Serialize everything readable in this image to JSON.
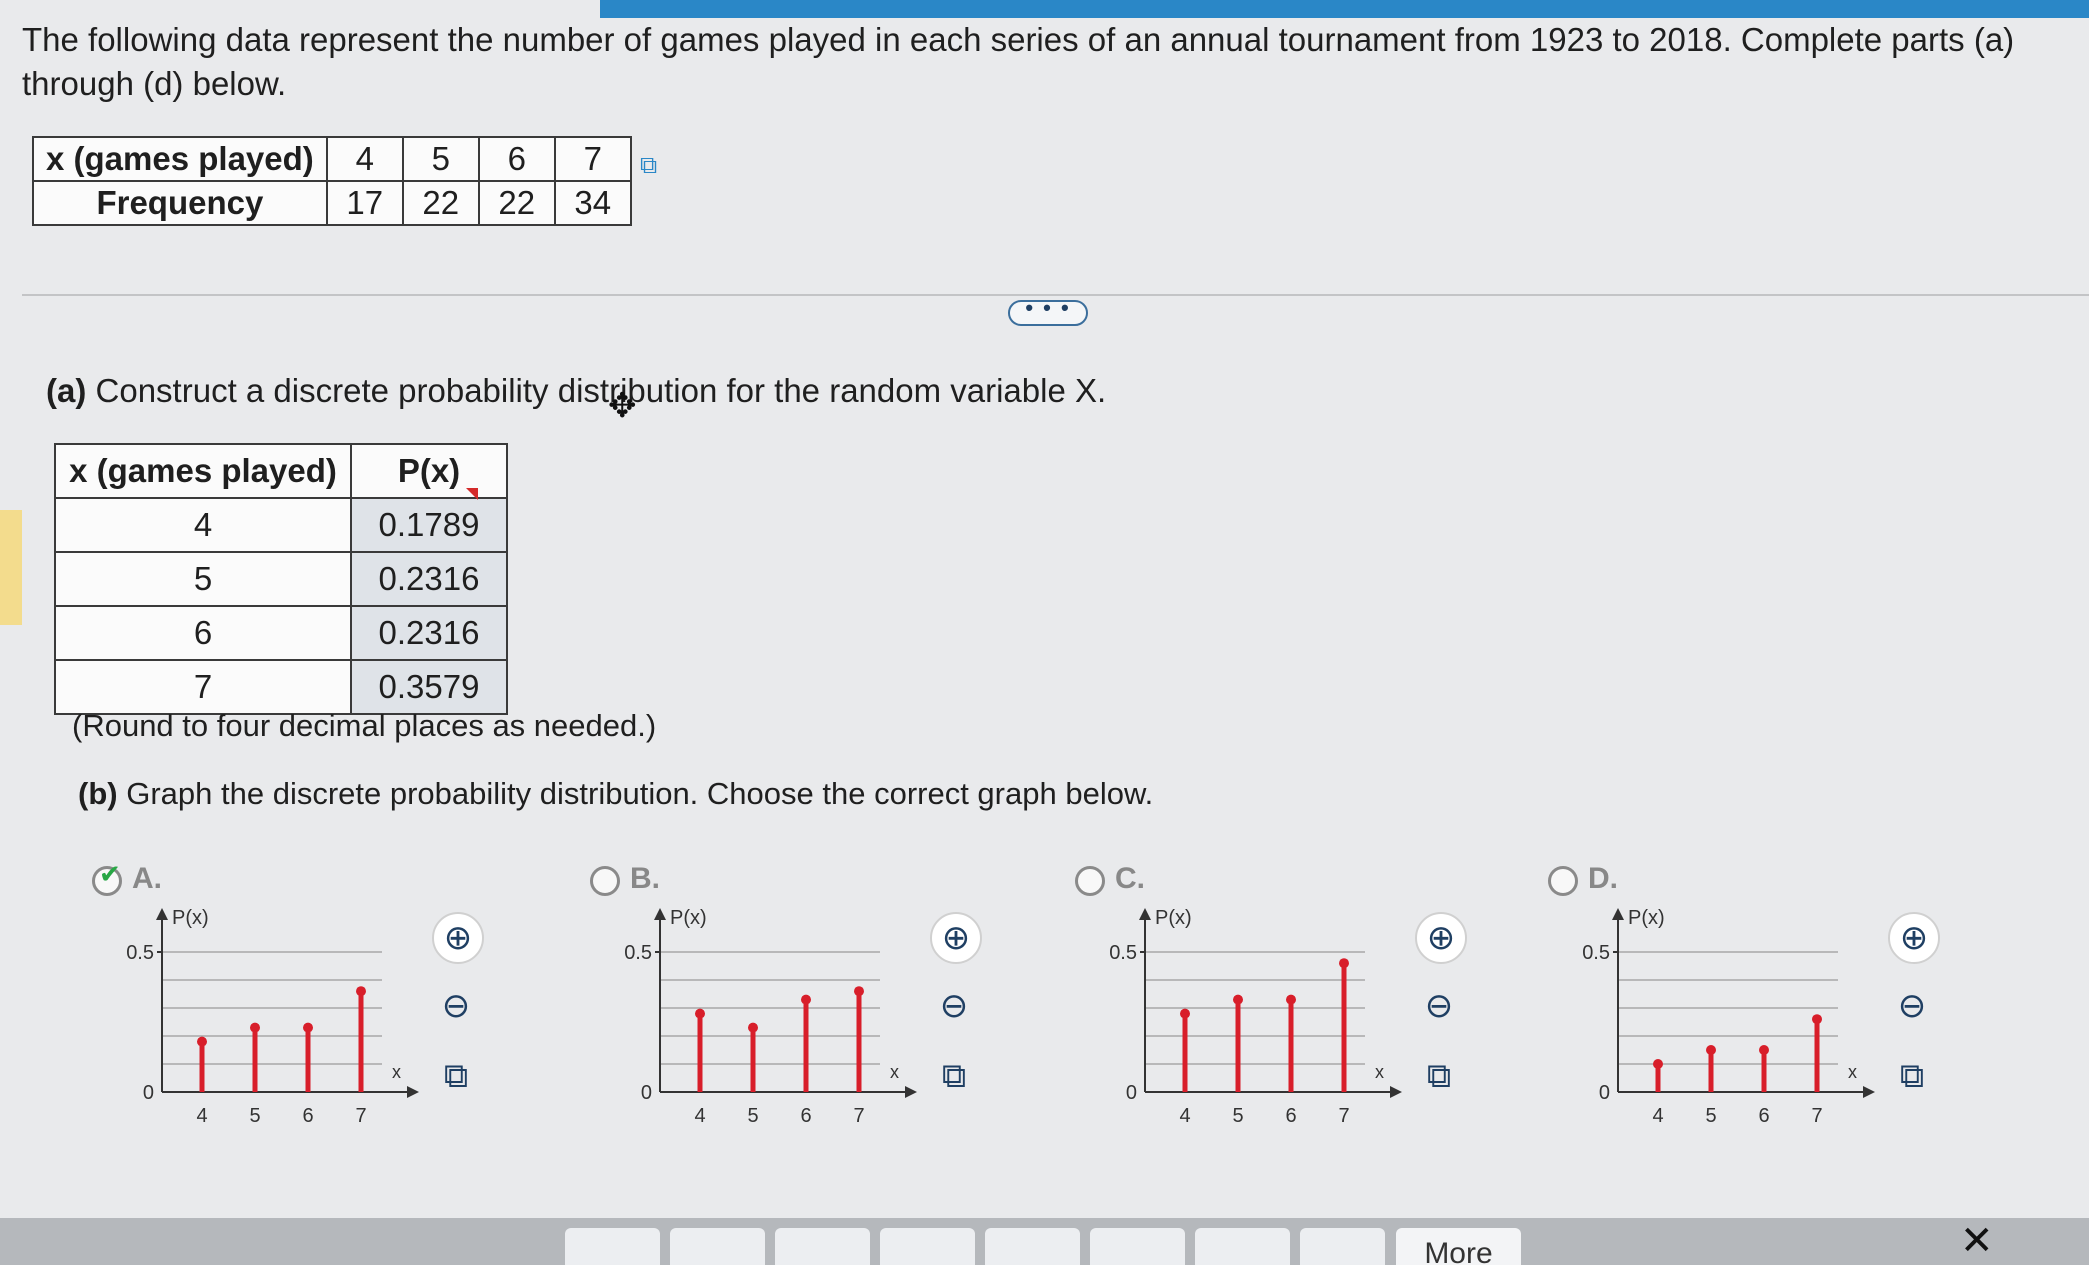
{
  "prompt": "The following data represent the number of games played in each series of an annual tournament from 1923 to 2018. Complete parts (a) through (d) below.",
  "freq_table": {
    "row1_header": "x (games played)",
    "row2_header": "Frequency",
    "x": [
      "4",
      "5",
      "6",
      "7"
    ],
    "freq": [
      "17",
      "22",
      "22",
      "34"
    ]
  },
  "more_label": "• • •",
  "part_a": {
    "label": "(a)",
    "text": "Construct a discrete probability distribution for the random variable X.",
    "col_x": "x (games played)",
    "col_p": "P(x)",
    "rows": [
      {
        "x": "4",
        "p": "0.1789"
      },
      {
        "x": "5",
        "p": "0.2316"
      },
      {
        "x": "6",
        "p": "0.2316"
      },
      {
        "x": "7",
        "p": "0.3579"
      }
    ],
    "note": "(Round to four decimal places as needed.)"
  },
  "part_b": {
    "label": "(b)",
    "text": "Graph the discrete probability distribution. Choose the correct graph below."
  },
  "options": [
    {
      "letter": "A.",
      "selected": true
    },
    {
      "letter": "B.",
      "selected": false
    },
    {
      "letter": "C.",
      "selected": false
    },
    {
      "letter": "D.",
      "selected": false
    }
  ],
  "chart_data": [
    {
      "type": "bar",
      "ylabel": "P(x)",
      "xlabel": "x",
      "categories": [
        "4",
        "5",
        "6",
        "7"
      ],
      "values": [
        0.18,
        0.23,
        0.23,
        0.36
      ],
      "ylim": [
        0,
        0.5
      ],
      "yticks": [
        "0",
        "0.5"
      ]
    },
    {
      "type": "bar",
      "ylabel": "P(x)",
      "xlabel": "x",
      "categories": [
        "4",
        "5",
        "6",
        "7"
      ],
      "values": [
        0.28,
        0.23,
        0.33,
        0.36
      ],
      "ylim": [
        0,
        0.5
      ],
      "yticks": [
        "0",
        "0.5"
      ]
    },
    {
      "type": "bar",
      "ylabel": "P(x)",
      "xlabel": "x",
      "categories": [
        "4",
        "5",
        "6",
        "7"
      ],
      "values": [
        0.28,
        0.33,
        0.33,
        0.46
      ],
      "ylim": [
        0,
        0.5
      ],
      "yticks": [
        "0",
        "0.5"
      ]
    },
    {
      "type": "bar",
      "ylabel": "P(x)",
      "xlabel": "x",
      "categories": [
        "4",
        "5",
        "6",
        "7"
      ],
      "values": [
        0.1,
        0.15,
        0.15,
        0.26
      ],
      "ylim": [
        0,
        0.5
      ],
      "yticks": [
        "0",
        "0.5"
      ]
    }
  ],
  "bottom_more": "More",
  "colors": {
    "bar": "#d81e2a",
    "accent": "#2a87c7",
    "check": "#28a745"
  }
}
